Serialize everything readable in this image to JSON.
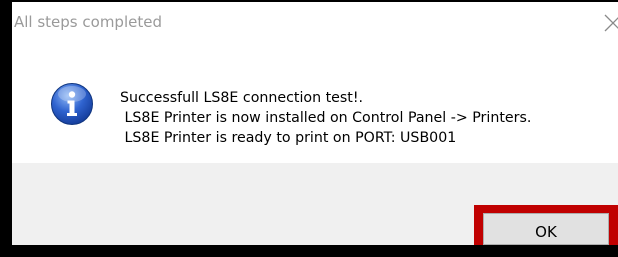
{
  "window": {
    "title": "All steps completed",
    "close_icon": "close-icon"
  },
  "message": {
    "icon": "info-icon",
    "lines": [
      "Successfull LS8E connection test!.",
      " LS8E Printer is now installed on Control Panel -> Printers.",
      " LS8E Printer is ready to print on PORT: USB001"
    ]
  },
  "buttons": {
    "ok_label": "OK"
  },
  "colors": {
    "highlight": "#c00000",
    "footer_bg": "#f0f0f0",
    "icon_blue": "#1f4fb8"
  }
}
